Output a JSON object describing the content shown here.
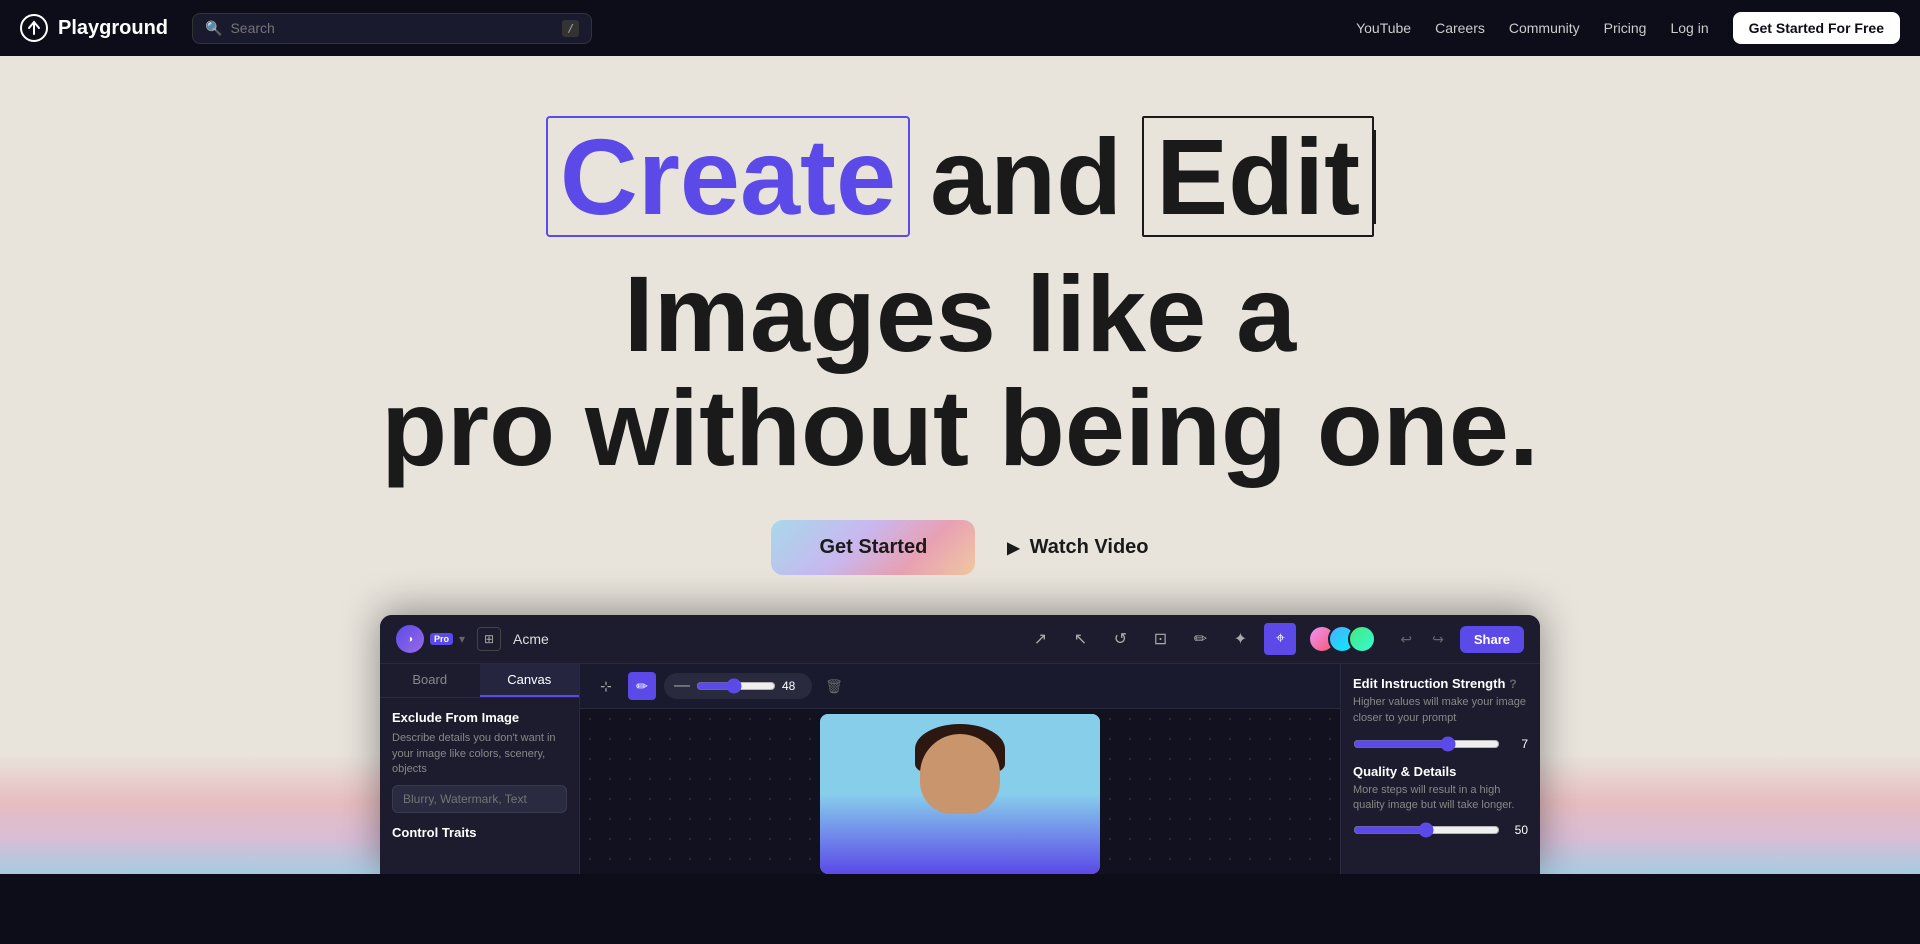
{
  "navbar": {
    "logo_text": "Playground",
    "search_placeholder": "Search",
    "search_slash": "/",
    "links": [
      {
        "label": "YouTube",
        "key": "youtube"
      },
      {
        "label": "Careers",
        "key": "careers"
      },
      {
        "label": "Community",
        "key": "community"
      },
      {
        "label": "Pricing",
        "key": "pricing"
      }
    ],
    "login_label": "Log in",
    "cta_label": "Get Started For Free"
  },
  "hero": {
    "headline_part1_create": "Create",
    "headline_part1_and": "and",
    "headline_part1_edit": "Edit",
    "headline_part1_rest": "Images like a",
    "headline_line2": "pro without being one.",
    "btn_get_started": "Get Started",
    "btn_watch_video": "Watch Video"
  },
  "mockup": {
    "workspace": "Acme",
    "pro_badge": "Pro",
    "share_btn": "Share",
    "tabs": {
      "board": "Board",
      "canvas": "Canvas"
    },
    "left_panel": {
      "section_title": "Exclude From Image",
      "section_desc": "Describe details you don't want in your image like colors, scenery, objects",
      "input_placeholder": "Blurry, Watermark, Text",
      "control_traits_label": "Control Traits"
    },
    "canvas_toolbar": {
      "brush_value": "48"
    },
    "right_panel": {
      "title": "Edit Instruction Strength",
      "desc": "Higher values will make your image closer to your prompt",
      "strength_value": "7",
      "quality_title": "Quality & Details",
      "quality_desc": "More steps will result in a high quality image but will take longer.",
      "quality_value": "50"
    }
  }
}
